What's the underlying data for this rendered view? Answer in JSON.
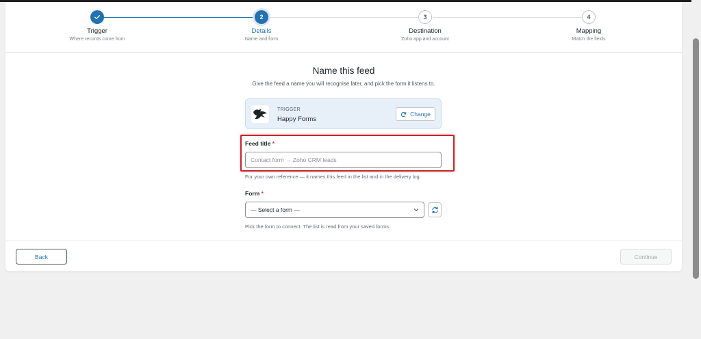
{
  "stepper": {
    "steps": [
      {
        "number": "",
        "label": "Trigger",
        "sub": "Where records come from",
        "state": "done"
      },
      {
        "number": "2",
        "label": "Details",
        "sub": "Name and form",
        "state": "active"
      },
      {
        "number": "3",
        "label": "Destination",
        "sub": "Zoho app and account",
        "state": "todo"
      },
      {
        "number": "4",
        "label": "Mapping",
        "sub": "Match the fields",
        "state": "todo"
      }
    ]
  },
  "main": {
    "title": "Name this feed",
    "subtitle": "Give the feed a name you will recognise later, and pick the form it listens to."
  },
  "trigger": {
    "kicker": "TRIGGER",
    "name": "Happy Forms",
    "change_label": "Change"
  },
  "feed_title": {
    "label": "Feed title",
    "required": "*",
    "placeholder": "Contact form → Zoho CRM leads",
    "help": "For your own reference — it names this feed in the list and in the delivery log."
  },
  "form": {
    "label": "Form",
    "required": "*",
    "selected": "— Select a form —",
    "help": "Pick the form to connect. The list is read from your saved forms."
  },
  "footer": {
    "back_label": "Back",
    "continue_label": "Continue"
  },
  "colors": {
    "accent": "#2271b1",
    "highlight": "#c4262e"
  },
  "icons": {
    "step_done": "checkmark-icon",
    "trigger": "happy-forms-logo-icon",
    "change": "refresh-icon",
    "select": "chevron-down-icon",
    "reload": "refresh-icon"
  }
}
